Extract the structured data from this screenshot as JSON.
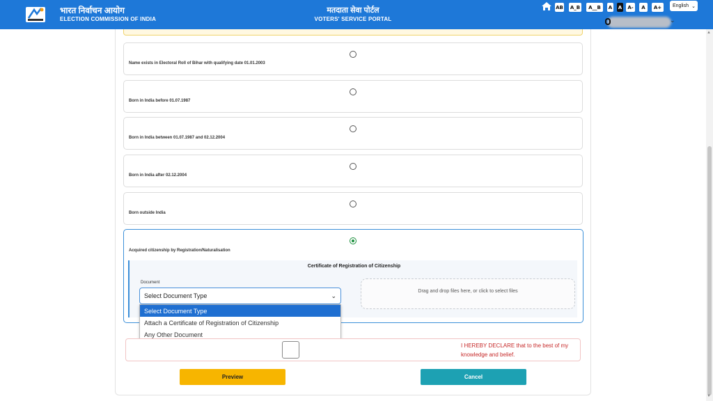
{
  "header": {
    "eci_hindi": "भारत निर्वाचन आयोग",
    "eci_english": "ELECTION COMMISSION OF INDIA",
    "portal_hindi": "मतदाता सेवा पोर्टल",
    "portal_english": "VOTERS' SERVICE PORTAL",
    "toolbar": [
      "AB",
      "A_B",
      "A__B",
      "A",
      "A",
      "A-",
      "A",
      "A+"
    ],
    "language": "English"
  },
  "options": [
    {
      "label": "Name exists in Electoral Roll of Bihar with qualifying date 01.01.2003",
      "selected": false
    },
    {
      "label": "Born in India before 01.07.1987",
      "selected": false
    },
    {
      "label": "Born in India between 01.07.1987 and 02.12.2004",
      "selected": false
    },
    {
      "label": "Born in India after 02.12.2004",
      "selected": false
    },
    {
      "label": "Born outside India",
      "selected": false
    },
    {
      "label": "Acquired citizenship by Registration/Naturalisation",
      "selected": true
    }
  ],
  "certificate": {
    "title": "Certificate of Registration of Citizenship",
    "document_label": "Document",
    "selected_value": "Select Document Type",
    "dropzone_text": "Drag and drop files here, or click to select files",
    "dropdown_options": [
      "Select Document Type",
      "Attach a Certificate of Registration of Citizenship",
      "Any Other Document"
    ]
  },
  "declaration": {
    "text": "I HEREBY DECLARE that to the best of my knowledge and belief."
  },
  "buttons": {
    "preview": "Preview",
    "cancel": "Cancel"
  },
  "colors": {
    "header_bg": "#1e78d8",
    "preview_bg": "#f7b500",
    "cancel_bg": "#1da1b3",
    "selected_radio": "#1a8f3c",
    "declare_text": "#c62828"
  }
}
